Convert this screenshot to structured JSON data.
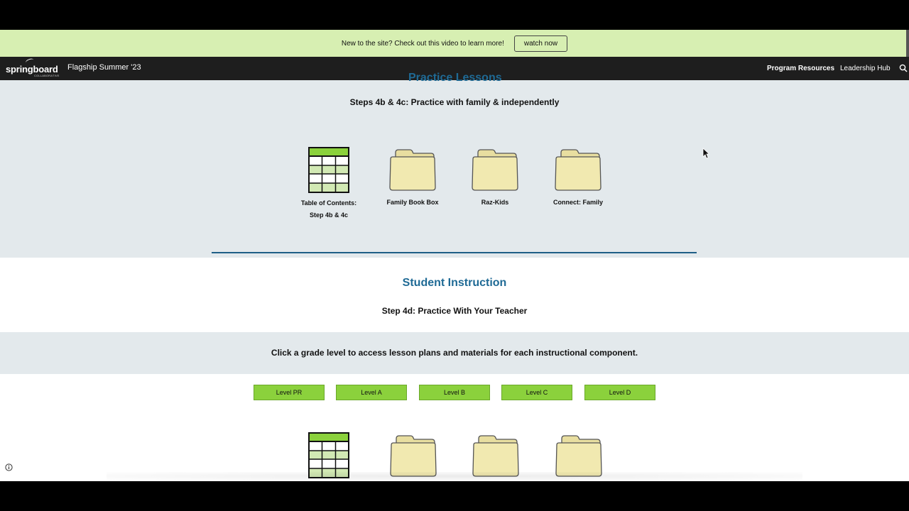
{
  "banner": {
    "message": "New to the site? Check out this video to learn more!",
    "button_label": "watch now"
  },
  "navbar": {
    "logo_text": "springboard",
    "logo_subtext": "COLLABORATIVE",
    "site_title": "Flagship Summer '23",
    "links": [
      "Program Resources",
      "Leadership Hub"
    ],
    "search_icon": "search-icon"
  },
  "family_section": {
    "cut_off_heading": "Practice Lessons",
    "steps_heading": "Steps 4b & 4c: Practice with family & independently",
    "tiles": [
      {
        "icon": "table-icon",
        "label_line1": "Table of Contents:",
        "label_line2": "Step 4b & 4c"
      },
      {
        "icon": "folder-icon",
        "label_line1": "Family Book Box"
      },
      {
        "icon": "folder-icon",
        "label_line1": "Raz-Kids"
      },
      {
        "icon": "folder-icon",
        "label_line1": "Connect: Family"
      }
    ]
  },
  "student_section": {
    "heading": "Student Instruction",
    "step": "Step 4d: Practice With Your Teacher"
  },
  "click_section": {
    "text": "Click a grade level to access lesson plans and materials for each instructional component."
  },
  "levels": [
    "Level PR",
    "Level A",
    "Level B",
    "Level C",
    "Level D"
  ],
  "colors": {
    "banner_bg": "#d7efb2",
    "nav_bg": "#1e1e1e",
    "section_bg": "#e3e9ec",
    "heading_blue": "#1f6a95",
    "level_green": "#8bd13c",
    "table_green": "#8bd13c",
    "folder_fill": "#f1e9b0"
  }
}
